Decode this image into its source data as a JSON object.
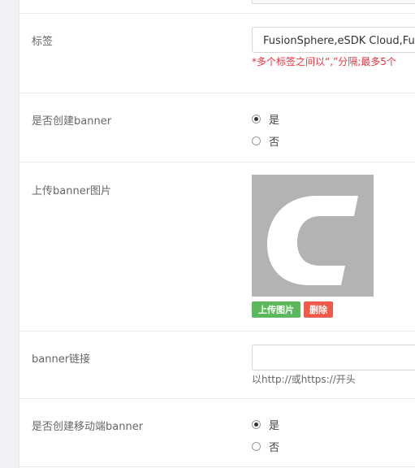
{
  "tags": {
    "label": "标签",
    "value": "FusionSphere,eSDK Cloud,Fu",
    "hint": "*多个标签之间以“,”分隔;最多5个"
  },
  "create_banner": {
    "label": "是否创建banner",
    "options": [
      {
        "label": "是",
        "checked": true
      },
      {
        "label": "否",
        "checked": false
      }
    ]
  },
  "upload_banner": {
    "label": "上传banner图片",
    "upload_button": "上传图片",
    "delete_button": "删除"
  },
  "banner_link": {
    "label": "banner链接",
    "value": "",
    "hint": "以http://或https://开头"
  },
  "create_mobile_banner": {
    "label": "是否创建移动端banner",
    "options": [
      {
        "label": "是",
        "checked": true
      },
      {
        "label": "否",
        "checked": false
      }
    ]
  },
  "colors": {
    "page_background": "#f1f2f6",
    "hint_red": "#e8323c",
    "upload_green": "#5cb85c",
    "delete_red": "#f05a4a",
    "preview_gray": "#b3b3b3"
  }
}
